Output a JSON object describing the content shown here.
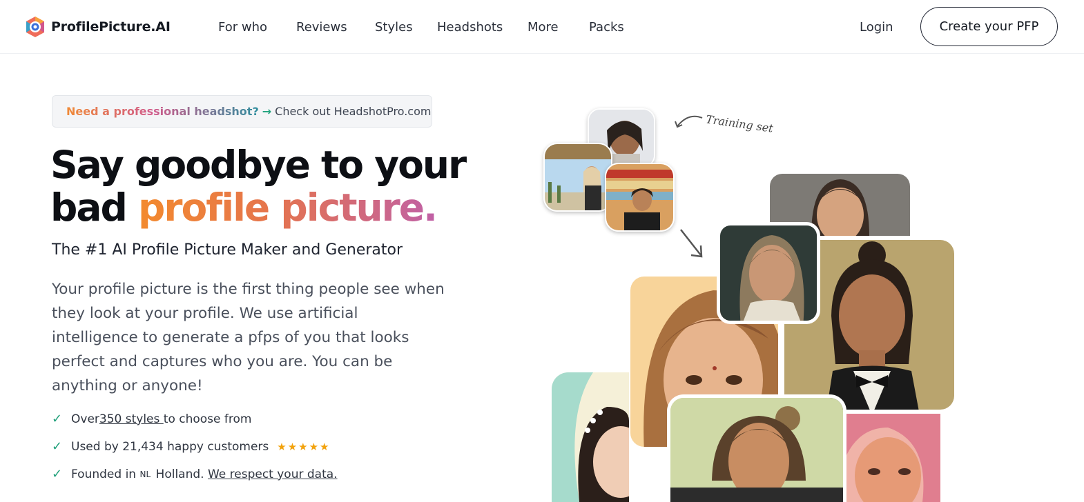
{
  "brand": {
    "name": "ProfilePicture.AI"
  },
  "nav": {
    "items": [
      "For who",
      "Reviews",
      "Styles",
      "Headshots",
      "More",
      "Packs"
    ],
    "login": "Login",
    "cta": "Create your PFP"
  },
  "banner": {
    "highlight": "Need a professional headshot?",
    "arrow": "→",
    "link": "Check out HeadshotPro.com"
  },
  "hero": {
    "title_line1": "Say goodbye to your",
    "title_line2_plain": "bad ",
    "title_line2_gradient": "profile picture.",
    "subtitle": "The #1 AI Profile Picture Maker and Generator",
    "description": "Your profile picture is the first thing people see when they look at your profile. We use artificial intelligence to generate a pfps of you that looks perfect and captures who you are. You can be anything or anyone!"
  },
  "checklist": {
    "item1_prefix": "Over ",
    "item1_link": "350 styles ",
    "item1_suffix": "to choose from",
    "item2": "Used by 21,434 happy customers",
    "item2_stars": "★★★★★",
    "item2_rating": 5,
    "item3_prefix": "Founded in ",
    "item3_flag": "NL",
    "item3_mid": " Holland. ",
    "item3_link": "We respect your data."
  },
  "collage": {
    "training_label": "Training set"
  },
  "colors": {
    "accent_orange": "#f38a2e",
    "accent_pink": "#c060a6",
    "check_green": "#1fa07a",
    "star_gold": "#f2a20c"
  }
}
